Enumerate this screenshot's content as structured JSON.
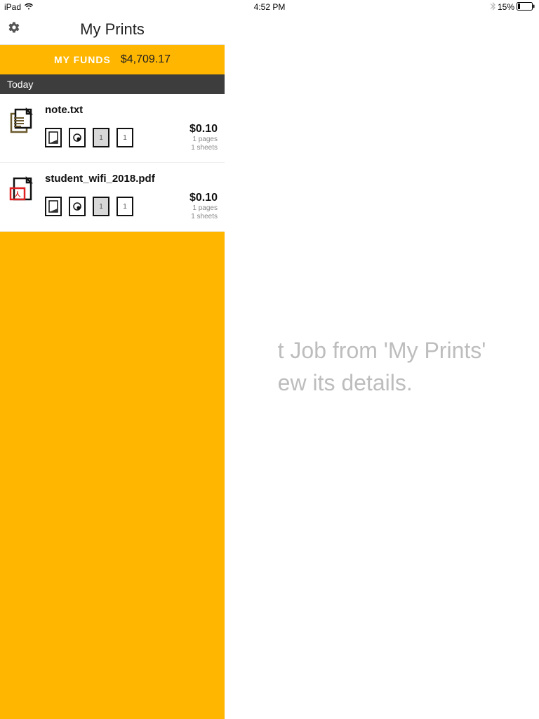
{
  "status": {
    "carrier": "iPad",
    "time": "4:52 PM",
    "battery": "15%"
  },
  "header": {
    "title": "My Prints"
  },
  "funds": {
    "label": "MY FUNDS",
    "amount": "$4,709.17"
  },
  "section": {
    "today": "Today"
  },
  "jobs": [
    {
      "name": "note.txt",
      "price": "$0.10",
      "pages": "1 pages",
      "sheets": "1 sheets",
      "count1": "1",
      "count2": "1",
      "type": "txt"
    },
    {
      "name": "student_wifi_2018.pdf",
      "price": "$0.10",
      "pages": "1 pages",
      "sheets": "1 sheets",
      "count1": "1",
      "count2": "1",
      "type": "pdf"
    }
  ],
  "detail": {
    "line1": "t Job from 'My Prints'",
    "line2": "ew its details."
  }
}
